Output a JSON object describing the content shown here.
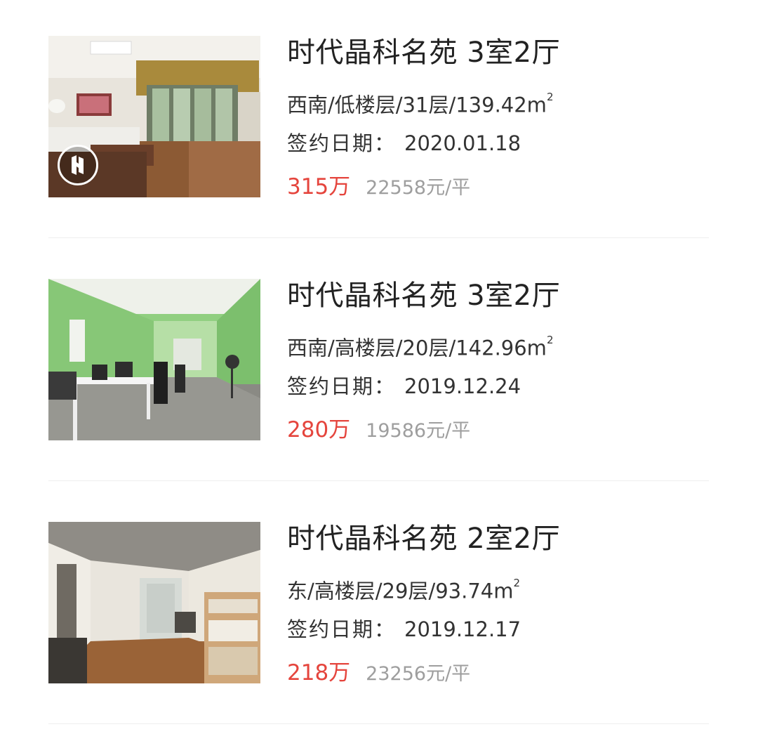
{
  "listings": [
    {
      "title": "时代晶科名苑 3室2厅",
      "meta": "西南/低楼层/31层/139.42m",
      "area_sup": "2",
      "sign_label": "签约日期：",
      "sign_date": "2020.01.18",
      "total_price": "315万",
      "unit_price": "22558元/平",
      "has_vr_badge": true
    },
    {
      "title": "时代晶科名苑 3室2厅",
      "meta": "西南/高楼层/20层/142.96m",
      "area_sup": "2",
      "sign_label": "签约日期：",
      "sign_date": "2019.12.24",
      "total_price": "280万",
      "unit_price": "19586元/平",
      "has_vr_badge": false
    },
    {
      "title": "时代晶科名苑 2室2厅",
      "meta": "东/高楼层/29层/93.74m",
      "area_sup": "2",
      "sign_label": "签约日期：",
      "sign_date": "2019.12.17",
      "total_price": "218万",
      "unit_price": "23256元/平",
      "has_vr_badge": false
    }
  ],
  "colors": {
    "price_red": "#e5453d",
    "unit_price_gray": "#9e9e9e",
    "title_text": "#222222",
    "divider": "#eeeeee"
  },
  "icons": {
    "vr_badge": "vr-tour-icon"
  }
}
